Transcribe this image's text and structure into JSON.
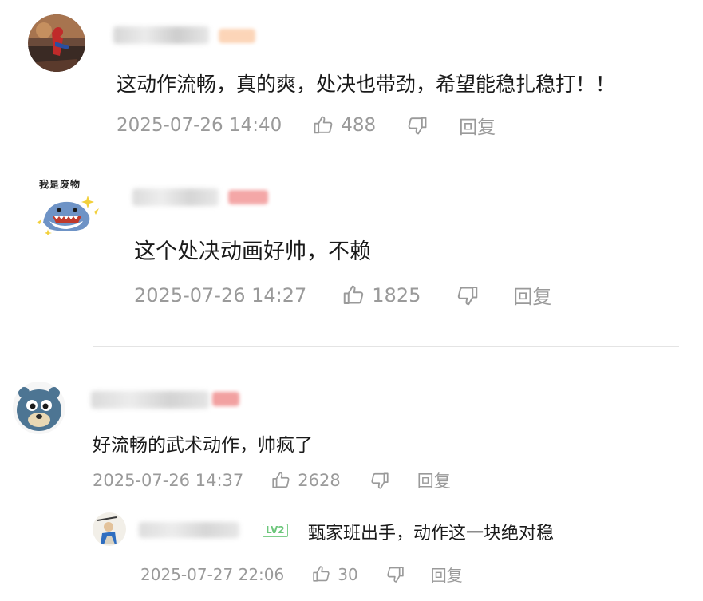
{
  "comments": [
    {
      "text": "这动作流畅，真的爽，处决也带劲，希望能稳扎稳打！！",
      "time": "2025-07-26 14:40",
      "likes": "488",
      "reply_label": "回复"
    },
    {
      "text": "这个处决动画好帅，不赖",
      "time": "2025-07-26 14:27",
      "likes": "1825",
      "reply_label": "回复"
    },
    {
      "text": "好流畅的武术动作，帅疯了",
      "time": "2025-07-26 14:37",
      "likes": "2628",
      "reply_label": "回复"
    },
    {
      "text": "甄家班出手，动作这一块绝对稳",
      "time": "2025-07-27 22:06",
      "likes": "30",
      "reply_label": "回复",
      "level_badge": "LV2"
    }
  ],
  "avatar_labels": {
    "shark": "我是废物"
  },
  "icons": {
    "like": "thumbs-up-icon",
    "dislike": "thumbs-down-icon"
  },
  "colors": {
    "meta_text": "#9a9a9a",
    "body_text": "#1a1a1a",
    "level_badge": "#6cc67b",
    "divider": "#e4e4e4"
  }
}
